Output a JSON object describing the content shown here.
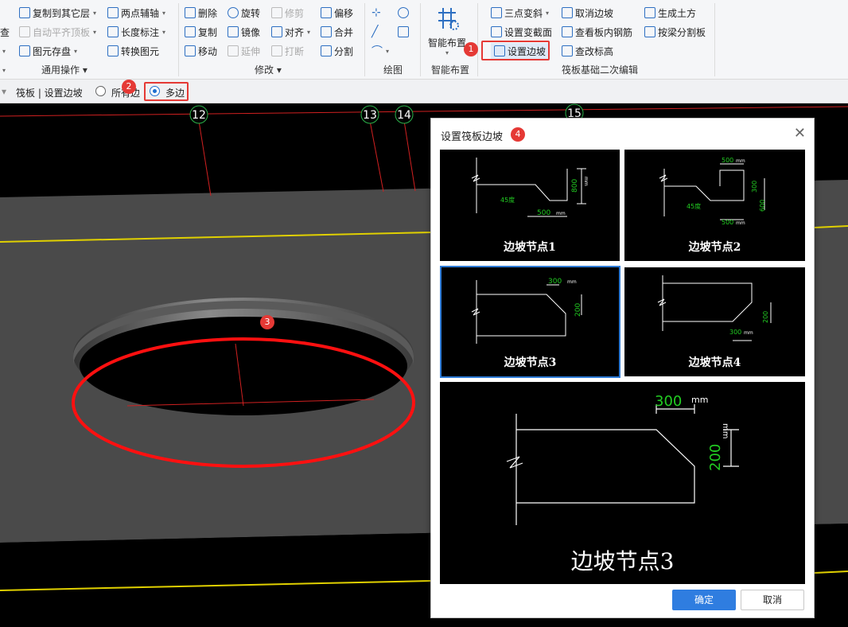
{
  "ribbon": {
    "col0": [
      "查",
      "",
      ""
    ],
    "common": {
      "copy_to_layer": "复制到其它层",
      "auto_flat_top": "自动平齐顶板",
      "element_save": "图元存盘",
      "two_point_axis": "两点辅轴",
      "length_mark": "长度标注",
      "convert_element": "转换图元",
      "group_label": "通用操作"
    },
    "modify": {
      "delete": "删除",
      "rotate": "旋转",
      "trim": "修剪",
      "offset": "偏移",
      "copy": "复制",
      "mirror": "镜像",
      "align": "对齐",
      "merge": "合并",
      "move": "移动",
      "extend": "延伸",
      "break": "打断",
      "split": "分割",
      "group_label": "修改"
    },
    "draw": {
      "group_label": "绘图"
    },
    "smart": {
      "button": "智能布置",
      "group_label": "智能布置"
    },
    "raft": {
      "three_point_slope": "三点变斜",
      "set_section": "设置变截面",
      "set_slope": "设置边坡",
      "cancel_slope": "取消边坡",
      "view_rebar": "查看板内钢筋",
      "check_elev": "查改标高",
      "gen_earth": "生成土方",
      "split_by_beam": "按梁分割板",
      "group_label": "筏板基础二次编辑"
    }
  },
  "toolbar2": {
    "breadcrumb": "筏板 | 设置边坡",
    "opt_all": "所有边",
    "opt_multi": "多边"
  },
  "axes": [
    "12",
    "13",
    "14",
    "15"
  ],
  "badges": [
    "1",
    "2",
    "3",
    "4"
  ],
  "dialog": {
    "title": "设置筏板边坡",
    "panels": [
      {
        "caption": "边坡节点1",
        "angle": "45度",
        "width": "500",
        "height": "800",
        "unit": "mm"
      },
      {
        "caption": "边坡节点2",
        "angle": "45度",
        "width": "500",
        "width2": "500",
        "height": "300",
        "height2": "600",
        "unit": "mm"
      },
      {
        "caption": "边坡节点3",
        "width": "300",
        "height": "200",
        "unit": "mm"
      },
      {
        "caption": "边坡节点4",
        "width": "300",
        "height": "200",
        "unit": "mm"
      }
    ],
    "preview": {
      "caption": "边坡节点3",
      "width": "300",
      "height": "200",
      "unit": "mm"
    },
    "selected_index": 2,
    "ok": "确定",
    "cancel": "取消"
  },
  "colors": {
    "accent": "#2f7de0",
    "highlight": "#e53935",
    "dim_green": "#22cc22"
  }
}
